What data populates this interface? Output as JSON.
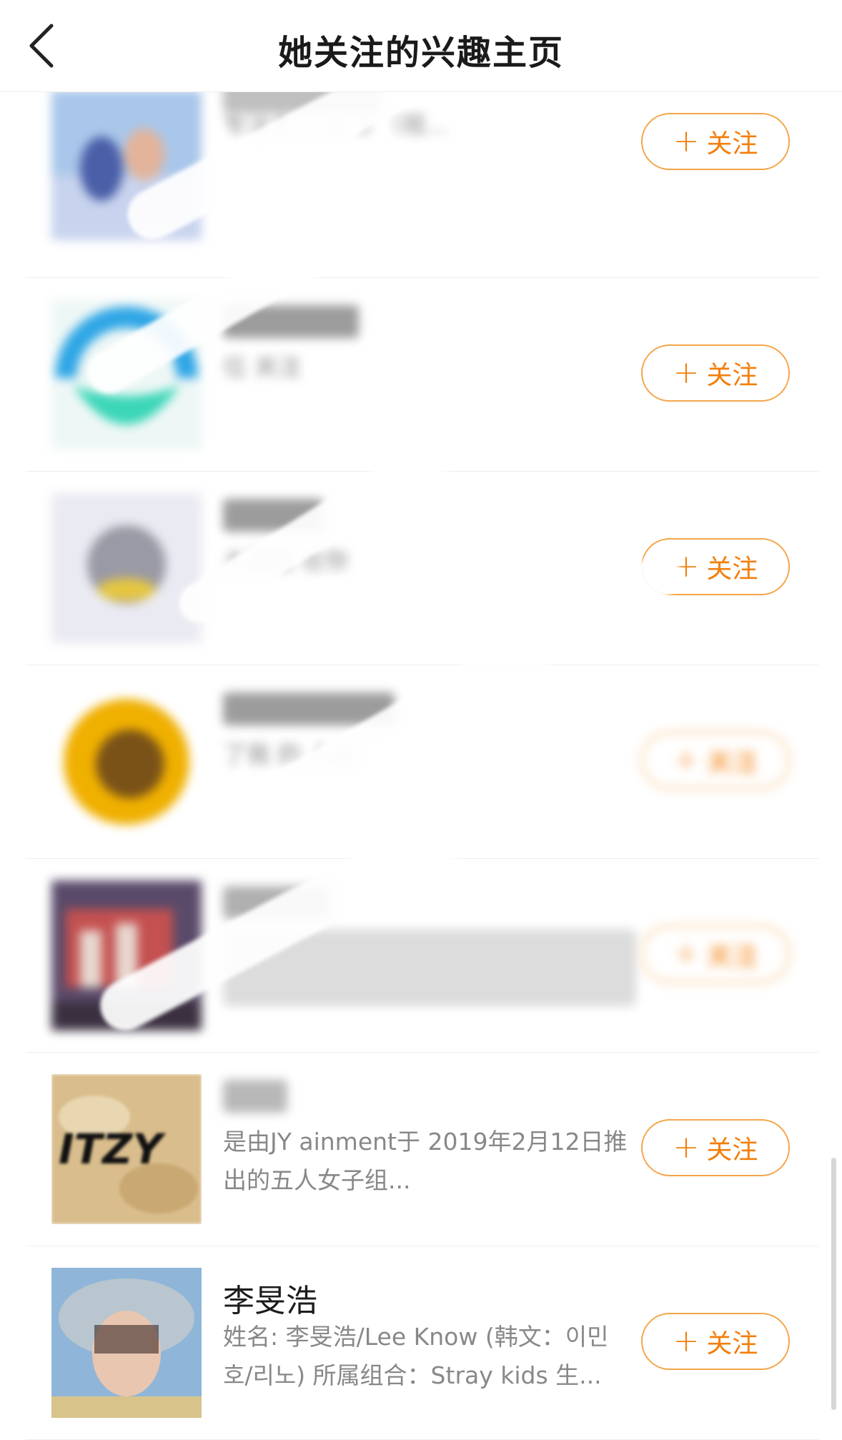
{
  "header": {
    "title": "她关注的兴趣主页",
    "back_icon": "chevron-left-icon"
  },
  "follow_label": "关注",
  "items": [
    {
      "name": "",
      "desc": "专注于 ：入 3 （视...",
      "button": "关注",
      "thumb_icon": "album-cover-illustration"
    },
    {
      "name": "",
      "desc": "位 关注",
      "button": "关注",
      "thumb_icon": "teal-logo"
    },
    {
      "name": "",
      "desc": "大道理 在你",
      "button": "关注",
      "thumb_icon": "blurred-photo"
    },
    {
      "name": "",
      "desc": "了我 的 人生",
      "button": "关注",
      "thumb_icon": "sunflower-photo"
    },
    {
      "name": "",
      "desc": "",
      "button": "关注",
      "thumb_icon": "group-stage-photo"
    },
    {
      "name": "",
      "desc": "是由JY ainment于 2019年2月12日推出的五人女子组...",
      "button": "关注",
      "thumb_icon": "itzy-logo"
    },
    {
      "name": "李旻浩",
      "desc": "姓名: 李旻浩/Lee Know (韩文：이민호/리노) 所属组合：Stray kids 生...",
      "button": "关注",
      "thumb_icon": "portrait-photo"
    }
  ],
  "colors": {
    "accent": "#f27f0c",
    "button_border": "#f5a54a",
    "text_primary": "#1c1c1c",
    "text_secondary": "#888888"
  }
}
